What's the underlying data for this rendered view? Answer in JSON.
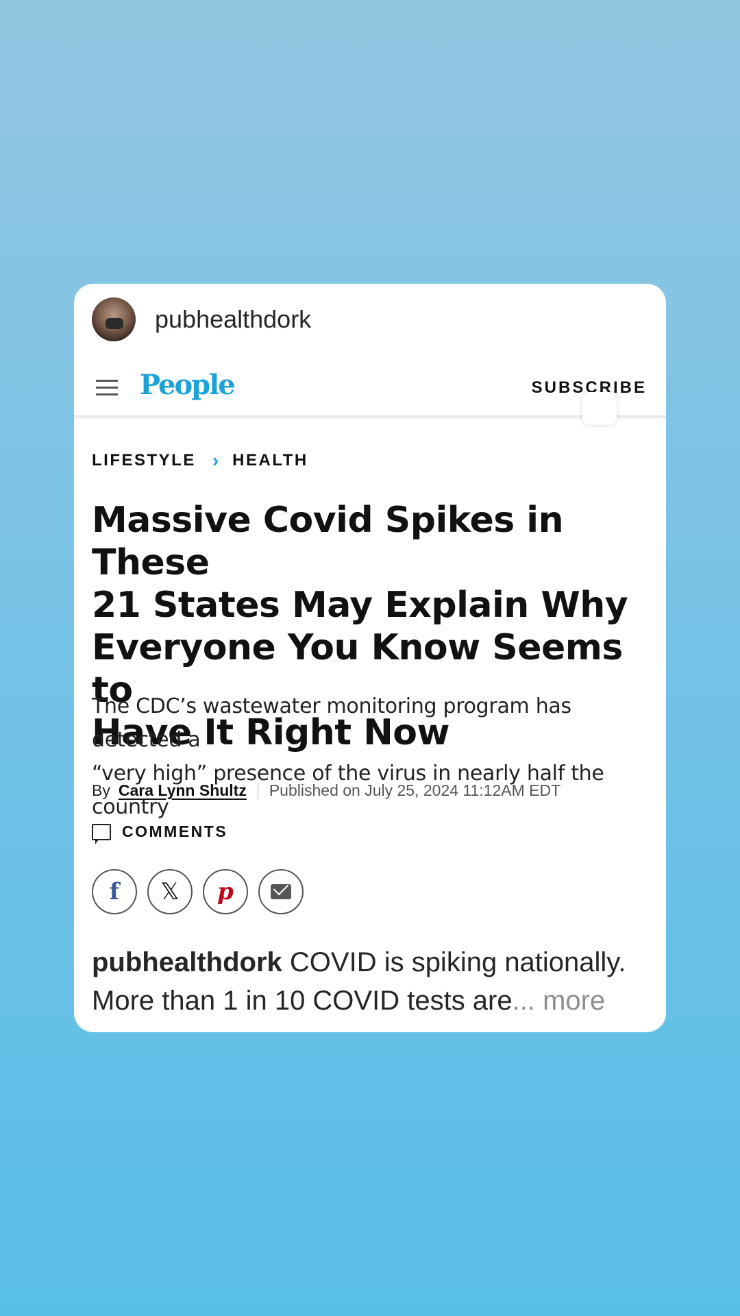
{
  "post": {
    "username": "pubhealthdork"
  },
  "site": {
    "logo_text": "People",
    "subscribe_label": "SUBSCRIBE",
    "brand_color": "#1da2d8"
  },
  "article": {
    "breadcrumb": {
      "section": "LIFESTYLE",
      "subsection": "HEALTH"
    },
    "headline_lines": [
      "Massive Covid Spikes in These",
      "21 States May Explain Why",
      "Everyone You Know Seems to",
      "Have It Right Now"
    ],
    "dek_lines": [
      "The CDC’s wastewater monitoring program has detected a",
      "“very high” presence of the virus in nearly half the country"
    ],
    "byline": {
      "by": "By",
      "author": "Cara Lynn Shultz",
      "published": "Published on July 25, 2024 11:12AM EDT"
    },
    "comments_label": "COMMENTS",
    "share": {
      "facebook_glyph": "f",
      "x_glyph": "𝕏",
      "pinterest_glyph": "p"
    }
  },
  "caption": {
    "username": "pubhealthdork",
    "text_line1": " COVID is spiking nationally.",
    "text_line2": "More than 1 in 10 COVID tests are",
    "ellipsis": "...",
    "more": " more"
  },
  "icons": [
    "menu-icon",
    "comment-icon",
    "facebook-icon",
    "x-icon",
    "pinterest-icon",
    "email-icon",
    "chevron-right-icon"
  ]
}
